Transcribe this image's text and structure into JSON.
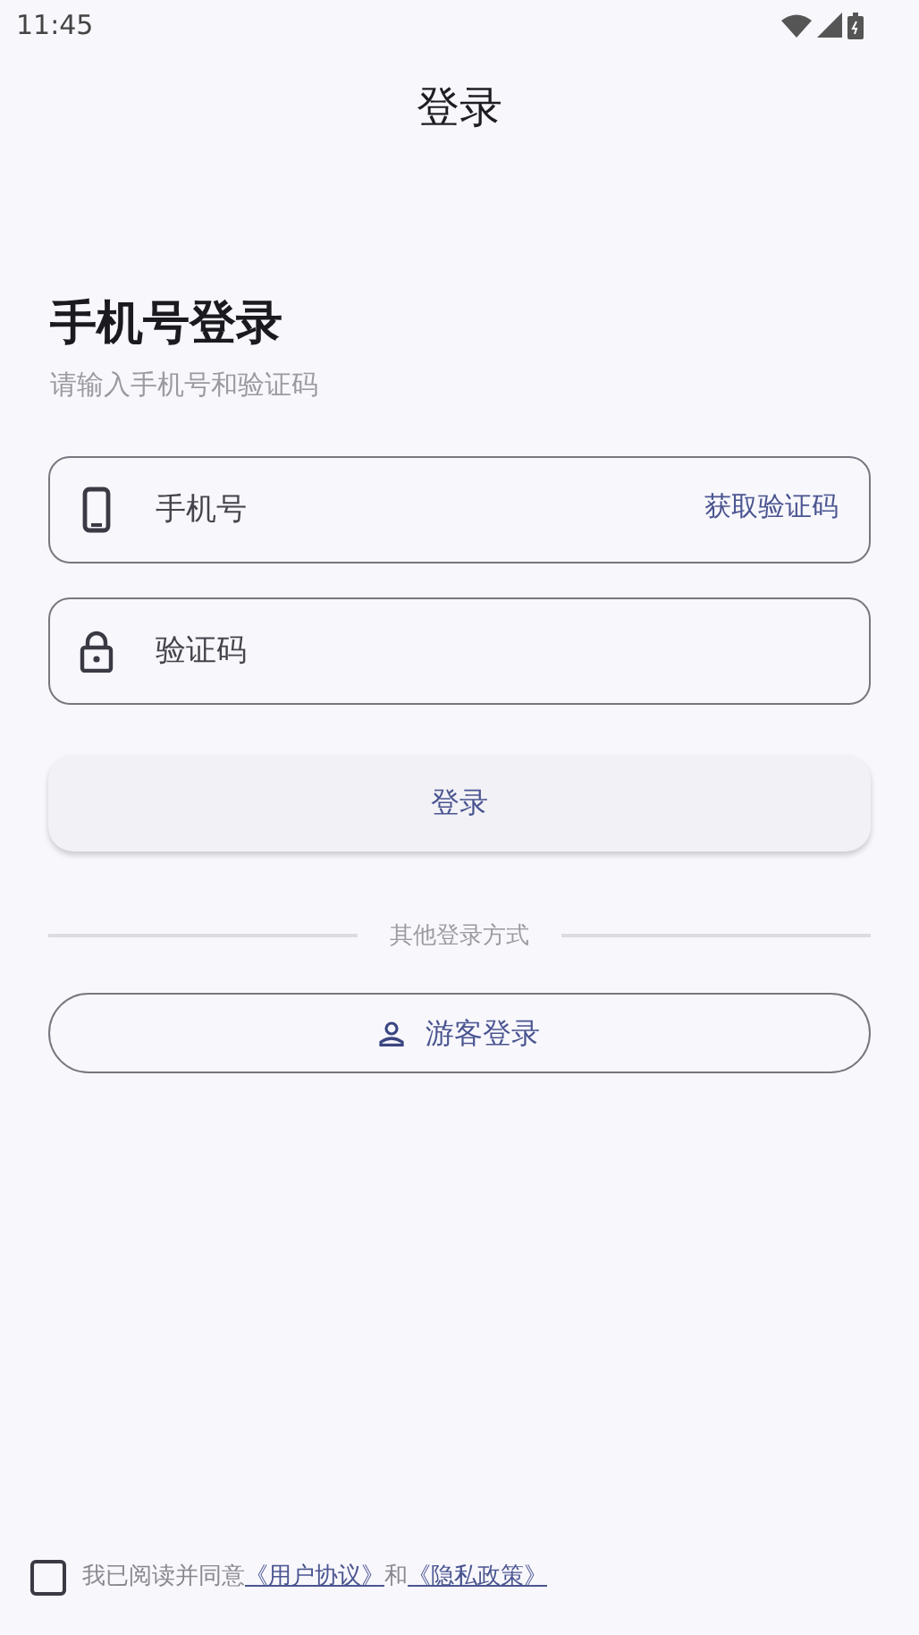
{
  "status_bar": {
    "time": "11:45"
  },
  "app_bar": {
    "title": "登录"
  },
  "heading": "手机号登录",
  "subtitle": "请输入手机号和验证码",
  "fields": [
    {
      "kind": "phone",
      "placeholder": "手机号",
      "action": "获取验证码"
    },
    {
      "kind": "code",
      "placeholder": "验证码"
    }
  ],
  "login_button": "登录",
  "divider_label": "其他登录方式",
  "guest_button": "游客登录",
  "agreement": {
    "checked": false,
    "prefix": "我已阅读并同意",
    "link_1": "《用户协议》",
    "joiner": "和",
    "link_2": "《隐私政策》"
  }
}
